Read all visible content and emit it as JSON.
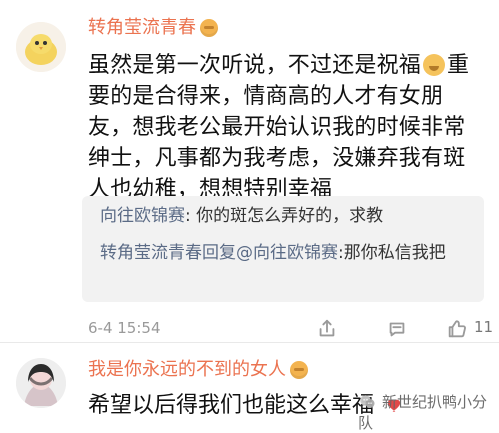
{
  "comment_main": {
    "username": "转角莹流青春",
    "text_before_emoji": "虽然是第一次听说，不过还是祝福",
    "text_after_emoji": "重要的是合得来，情商高的人才有女朋友，想我老公最开始认识我的时候非常绅士，凡事都为我考虑，没嫌弃我有斑人也幼稚，想想特别幸福"
  },
  "quote": {
    "line1_name": "向往欧锦赛",
    "line1_text": ": 你的斑怎么弄好的，求教",
    "line2_prefix": "转角莹流青春回复@向往欧锦赛",
    "line2_text": ":那你私信我把"
  },
  "meta": {
    "date_time": "6-4 15:54",
    "like_count": "11"
  },
  "comment_second": {
    "username": "我是你永远的不到的女人",
    "text": "希望以后得我们也能这么幸福"
  },
  "watermark": {
    "text": "新世纪扒鸭小分队"
  },
  "colors": {
    "accent": "#eb7350",
    "link": "#5b6b86",
    "quote_bg": "#f2f2f2"
  },
  "icons": {
    "share": "share-icon",
    "comment": "comment-icon",
    "like": "thumb-up-icon",
    "heart": "heart-icon",
    "watermark": "wechat-icon"
  }
}
